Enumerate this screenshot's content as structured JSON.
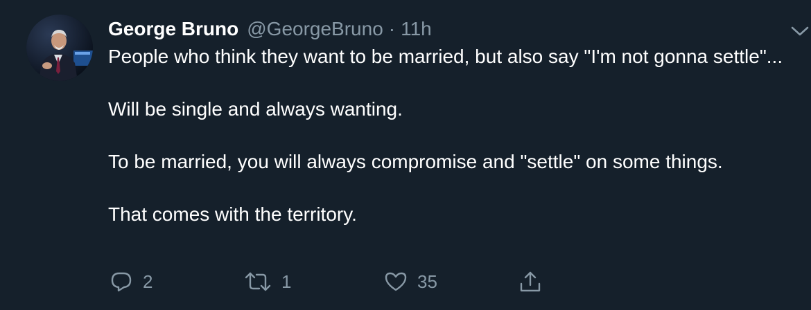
{
  "tweet": {
    "author_name": "George Bruno",
    "handle": "@GeorgeBruno",
    "separator": "·",
    "time": "11h",
    "paragraphs": [
      "People who think they want to be married, but also say \"I'm not gonna settle\"...",
      "Will be single and always wanting.",
      "To be married, you will always compromise and \"settle\" on some things.",
      "That comes with the territory."
    ]
  },
  "actions": {
    "reply_count": "2",
    "retweet_count": "1",
    "like_count": "35"
  },
  "icons": {
    "reply": "reply-icon",
    "retweet": "retweet-icon",
    "like": "heart-icon",
    "share": "share-icon",
    "menu": "chevron-down-icon"
  },
  "colors": {
    "background": "#15202b",
    "text_primary": "#ffffff",
    "text_secondary": "#8899a6"
  }
}
